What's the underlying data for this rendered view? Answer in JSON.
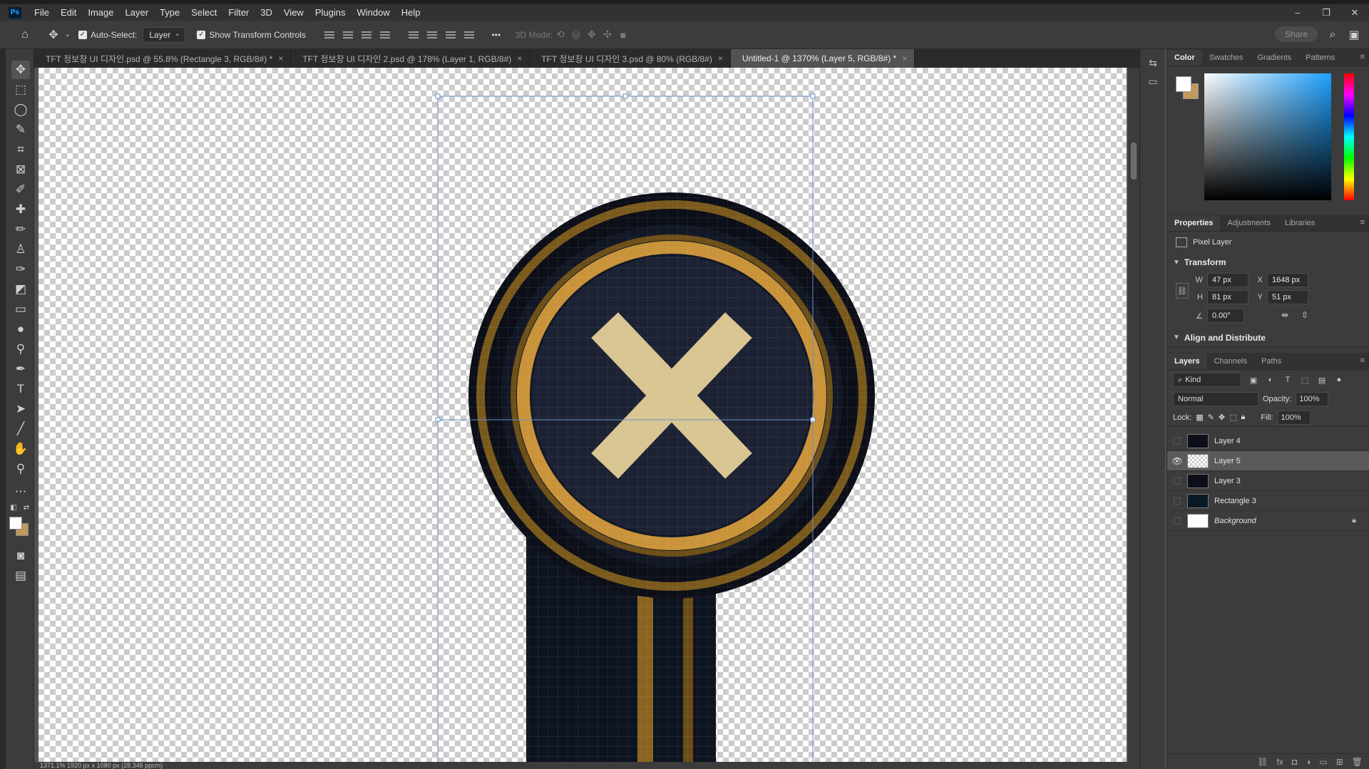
{
  "menubar": {
    "logo": "Ps",
    "items": [
      "File",
      "Edit",
      "Image",
      "Layer",
      "Type",
      "Select",
      "Filter",
      "3D",
      "View",
      "Plugins",
      "Window",
      "Help"
    ],
    "window_controls": [
      "–",
      "❐",
      "✕"
    ]
  },
  "options": {
    "auto_select_label": "Auto-Select:",
    "auto_select_value": "Layer",
    "show_transform_label": "Show Transform Controls",
    "more_label": "•••",
    "mode_label": "3D Mode:",
    "share_label": "Share"
  },
  "tabs": [
    {
      "label": "TFT 정보창 UI 디자인.psd @ 55.8% (Rectangle 3, RGB/8#) *",
      "active": false
    },
    {
      "label": "TFT 정보창 UI 디자인 2.psd @ 178% (Layer 1, RGB/8#)",
      "active": false
    },
    {
      "label": "TFT 정보창 UI 디자인 3.psd @ 80% (RGB/8#)",
      "active": false
    },
    {
      "label": "Untitled-1 @ 1370% (Layer 5, RGB/8#) *",
      "active": true
    }
  ],
  "status": {
    "text": "1371.1%   1920 px x 1080 px (28.346 ppcm)"
  },
  "color_panel": {
    "tabs": [
      "Color",
      "Swatches",
      "Gradients",
      "Patterns"
    ],
    "foreground": "#ffffff",
    "background": "#c19a5b"
  },
  "properties_panel": {
    "tabs": [
      "Properties",
      "Adjustments",
      "Libraries"
    ],
    "layer_type": "Pixel Layer",
    "transform_title": "Transform",
    "w_label": "W",
    "w_value": "47 px",
    "h_label": "H",
    "h_value": "81 px",
    "x_label": "X",
    "x_value": "1648 px",
    "y_label": "Y",
    "y_value": "51 px",
    "angle_value": "0.00°",
    "align_title": "Align and Distribute"
  },
  "layers_panel": {
    "tabs": [
      "Layers",
      "Channels",
      "Paths"
    ],
    "kind_label": "Kind",
    "blend_mode": "Normal",
    "opacity_label": "Opacity:",
    "opacity_value": "100%",
    "lock_label": "Lock:",
    "fill_label": "Fill:",
    "fill_value": "100%",
    "layers": [
      {
        "name": "Layer 4",
        "visible": false,
        "selected": false,
        "locked": false
      },
      {
        "name": "Layer 5",
        "visible": true,
        "selected": true,
        "locked": false
      },
      {
        "name": "Layer 3",
        "visible": false,
        "selected": false,
        "locked": false
      },
      {
        "name": "Rectangle 3",
        "visible": false,
        "selected": false,
        "locked": false
      },
      {
        "name": "Background",
        "visible": false,
        "selected": false,
        "locked": true
      }
    ]
  },
  "colors": {
    "gold": "#b8862e",
    "gold_light": "#e0b864",
    "navy": "#1a1f2e",
    "cream": "#d8c592",
    "ink": "#0c0f18"
  }
}
